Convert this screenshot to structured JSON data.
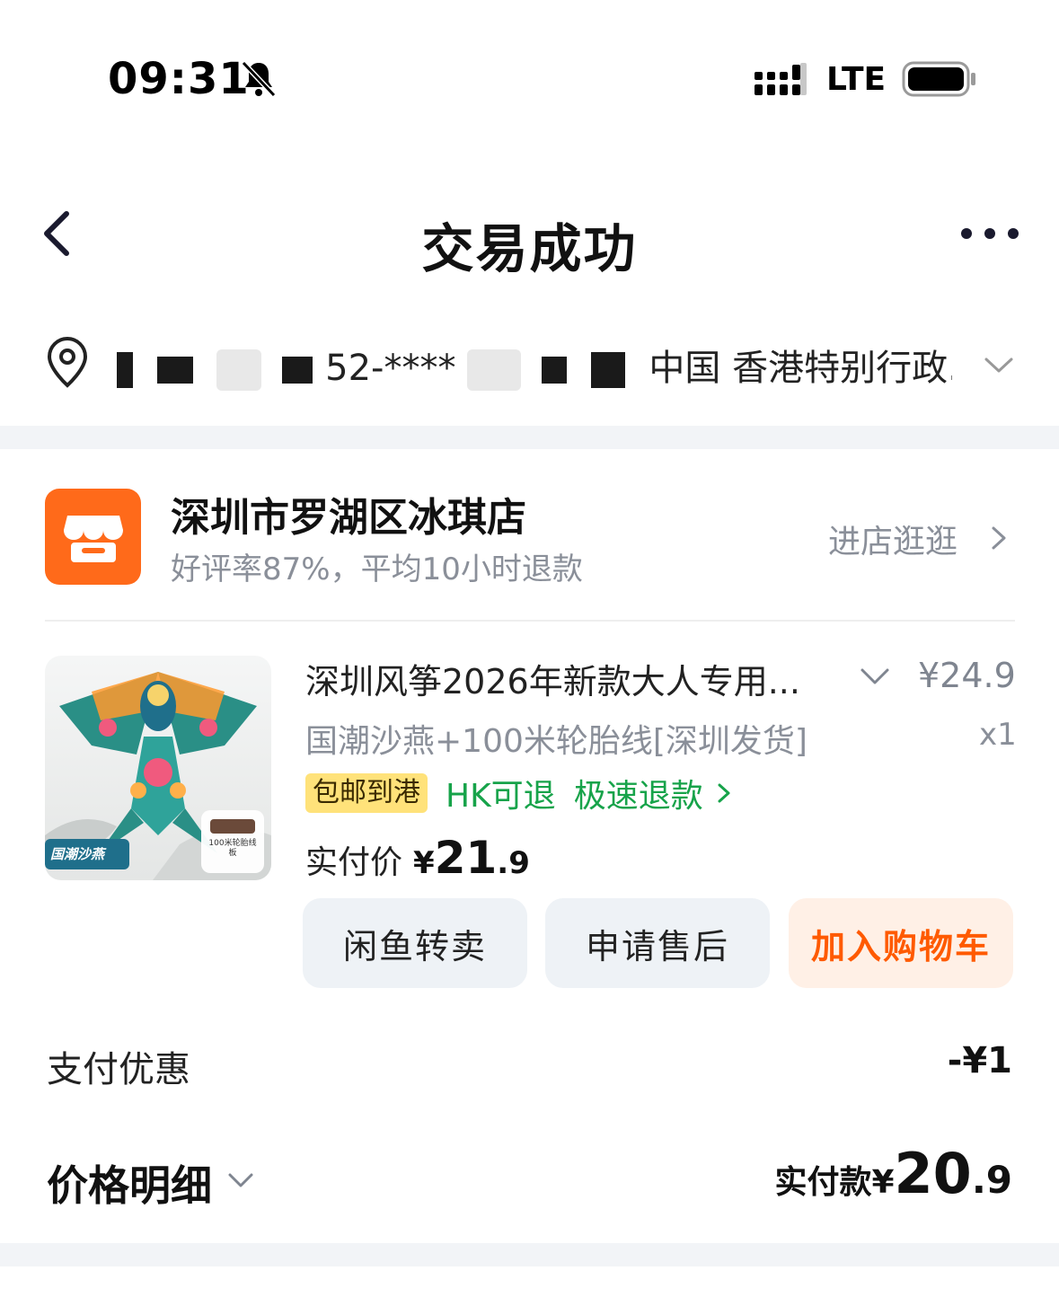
{
  "status_bar": {
    "time": "09:31",
    "network": "LTE",
    "icons": [
      "bell-muted-icon",
      "signal-icon",
      "battery-icon"
    ]
  },
  "nav": {
    "title": "交易成功",
    "icons": [
      "back-arrow-icon",
      "more-dots-icon"
    ]
  },
  "address": {
    "masked_phone": "52-****",
    "location": "中国 香港特别行政..."
  },
  "shop": {
    "name": "深圳市罗湖区冰琪店",
    "description": "好评率87%，平均10小时退款",
    "enter_label": "进店逛逛",
    "logo_color": "#ff6a1a"
  },
  "product": {
    "title": "深圳风筝2026年新款大人专用...",
    "price": "¥24.9",
    "spec": "国潮沙燕+100米轮胎线[深圳发货]",
    "quantity": "x1",
    "tags": {
      "free_shipping": "包邮到港",
      "returnable": "HK可退",
      "fast_refund": "极速退款"
    },
    "image_labels": {
      "badge": "国潮沙燕",
      "accessory": "100米轮胎线板"
    },
    "paid": {
      "label": "实付价",
      "currency": "¥",
      "integer": "21",
      "decimal": ".9"
    }
  },
  "actions": {
    "resell": "闲鱼转卖",
    "after_sale": "申请售后",
    "add_cart": "加入购物车"
  },
  "summary": {
    "discount_label": "支付优惠",
    "discount_value": "-¥1",
    "detail_label": "价格明细",
    "total_label": "实付款¥",
    "total_integer": "20",
    "total_decimal": ".9"
  },
  "colors": {
    "accent_orange": "#ff5a00",
    "refund_green": "#17a34a",
    "tag_yellow": "#ffe27a",
    "section_gray": "#f2f4f7"
  }
}
